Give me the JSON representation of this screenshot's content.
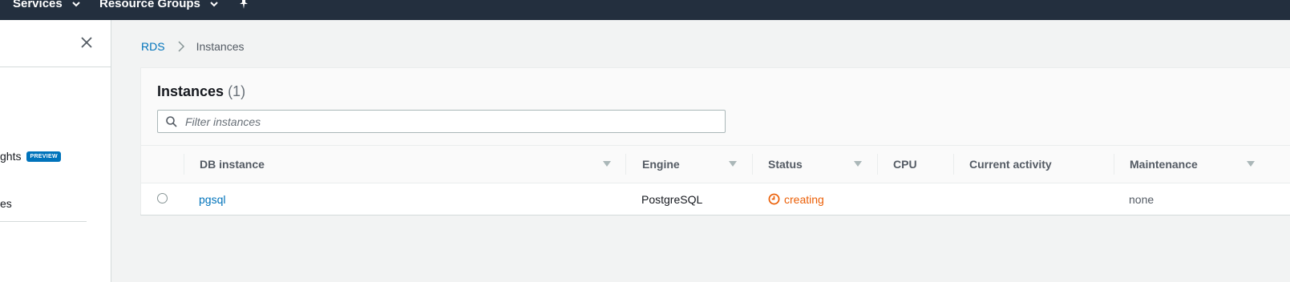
{
  "topnav": {
    "services_label": "Services",
    "resource_groups_label": "Resource Groups"
  },
  "sidebar": {
    "items": [
      {
        "label": "ghts",
        "badge": "PREVIEW"
      },
      {
        "label": "es"
      }
    ]
  },
  "breadcrumb": {
    "items": [
      "RDS",
      "Instances"
    ]
  },
  "panel": {
    "title": "Instances",
    "count": "(1)",
    "filter_placeholder": "Filter instances"
  },
  "table": {
    "columns": [
      "DB instance",
      "Engine",
      "Status",
      "CPU",
      "Current activity",
      "Maintenance"
    ],
    "rows": [
      {
        "db_instance": "pgsql",
        "engine": "PostgreSQL",
        "status": "creating",
        "cpu": "",
        "current_activity": "",
        "maintenance": "none"
      }
    ]
  },
  "colors": {
    "nav_bg": "#232f3e",
    "link": "#0073bb",
    "status_creating": "#eb5f07"
  }
}
